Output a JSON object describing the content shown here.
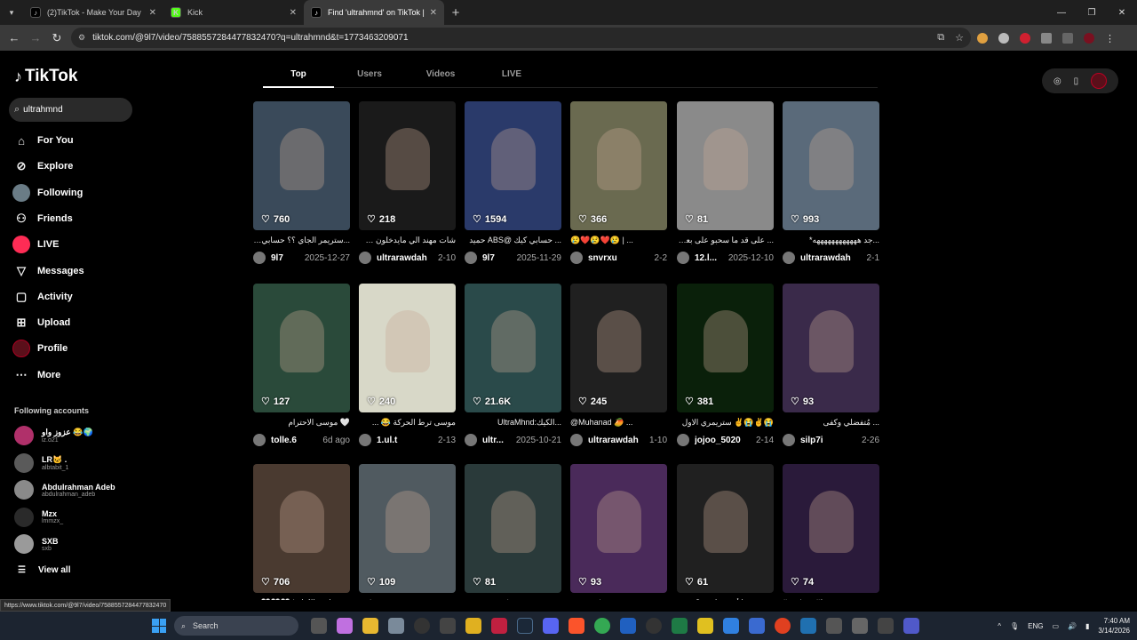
{
  "browser": {
    "tabs": [
      {
        "title": "(2)TikTok - Make Your Day",
        "favicon_color": "#000000",
        "active": false
      },
      {
        "title": "Kick",
        "favicon_color": "#53fc18",
        "active": false
      },
      {
        "title": "Find 'ultrahmnd' on TikTok | Tik",
        "favicon_color": "#000000",
        "active": true
      }
    ],
    "new_tab": "+",
    "url": "tiktok.com/@9l7/video/7588557284477832470?q=ultrahmnd&t=1773463209071"
  },
  "tiktok": {
    "logo": "TikTok",
    "search_value": "ultrahmnd",
    "nav": [
      {
        "label": "For You",
        "icon": "home-icon"
      },
      {
        "label": "Explore",
        "icon": "compass-icon"
      },
      {
        "label": "Following",
        "icon": "following-avatar-icon"
      },
      {
        "label": "Friends",
        "icon": "friends-icon"
      },
      {
        "label": "LIVE",
        "icon": "live-icon"
      },
      {
        "label": "Messages",
        "icon": "messages-icon"
      },
      {
        "label": "Activity",
        "icon": "activity-icon"
      },
      {
        "label": "Upload",
        "icon": "upload-icon"
      },
      {
        "label": "Profile",
        "icon": "profile-icon"
      },
      {
        "label": "More",
        "icon": "more-icon"
      }
    ],
    "following_title": "Following accounts",
    "following_accounts": [
      {
        "name": "عزوز واو 😂🌍",
        "handle": "iz.o21",
        "color": "#b0306a"
      },
      {
        "name": "LR🐱 .",
        "handle": "albtabit_1",
        "color": "#5a5a5a"
      },
      {
        "name": "Abdulrahman Adeb",
        "handle": "abdulrahman_adeb",
        "color": "#8a8a8a"
      },
      {
        "name": "Mzx",
        "handle": "lmmzx_",
        "color": "#2a2a2a"
      },
      {
        "name": "SXB",
        "handle": "sxb",
        "color": "#9a9a9a"
      }
    ],
    "view_all": "View all",
    "search_tabs": [
      "Top",
      "Users",
      "Videos",
      "LIVE"
    ],
    "active_tab": "Top",
    "videos": [
      {
        "views": "760",
        "caption": "...ستريمر الجاي ؟؟ حسابي كيك",
        "user": "9l7",
        "date": "2025-12-27",
        "bg": "#3a4a5a"
      },
      {
        "views": "218",
        "caption": "شات مهند الي مايدخلون 😂 أقسم بالله افضل شات",
        "user": "ultrarawdah",
        "date": "2-10",
        "bg": "#1a1a1a"
      },
      {
        "views": "1594",
        "caption": "... حسابي كيك @ABS حميد",
        "user": "9l7",
        "date": "2025-11-29",
        "bg": "#2a3a6a"
      },
      {
        "views": "366",
        "caption": "😢❤️😢❤️😢 | ...",
        "user": "snvrxu",
        "date": "2-2",
        "bg": "#6a6a50"
      },
      {
        "views": "81",
        "caption": "... على قد ما سحبو على بعض",
        "user": "12.l...",
        "date": "2025-12-10",
        "bg": "#8a8a8a"
      },
      {
        "views": "993",
        "caption": "...جد ههههههههههههه*",
        "user": "ultrarawdah",
        "date": "2-1",
        "bg": "#5a6a7a"
      },
      {
        "views": "127",
        "caption": "🤍 موسى الاحترام",
        "user": "tolle.6",
        "date": "6d ago",
        "bg": "#2a4a3a"
      },
      {
        "views": "240",
        "caption": "موسى ترط الحركة 😂 ...",
        "user": "1.ul.t",
        "date": "2-13",
        "bg": "#d8d8c8"
      },
      {
        "views": "21.6K",
        "caption": "...الكيك:UltraMhnd",
        "user": "ultr...",
        "date": "2025-10-21",
        "bg": "#2a4a4a"
      },
      {
        "views": "245",
        "caption": "@Muhanad 🥭 ...",
        "user": "ultrarawdah",
        "date": "1-10",
        "bg": "#202020"
      },
      {
        "views": "381",
        "caption": "😭✌️😭✌️ ستريمري الاول",
        "user": "jojoo_5020",
        "date": "2-14",
        "bg": "#0a200a"
      },
      {
        "views": "93",
        "caption": "... مُتفضلي وكفى",
        "user": "silp7i",
        "date": "2-26",
        "bg": "#3a2a4a"
      },
      {
        "views": "706",
        "caption": "...حسابي بالكيك | 🤍🤍🤍",
        "user": "",
        "date": "",
        "bg": "#4a3a30"
      },
      {
        "views": "109",
        "caption": "...ي عقده ههههههههههههه*",
        "user": "",
        "date": "",
        "bg": "#505a60"
      },
      {
        "views": "81",
        "caption": "...هههههههههههه*",
        "user": "",
        "date": "",
        "bg": "#2a3a3a"
      },
      {
        "views": "93",
        "caption": "...يوم هههههههههههه*",
        "user": "",
        "date": "",
        "bg": "#4a2a5a"
      },
      {
        "views": "61",
        "caption": "...ترند وما أسويه لمهند؟ عربيه",
        "user": "",
        "date": "",
        "bg": "#202020"
      },
      {
        "views": "74",
        "caption": "#explore #fyp ...",
        "user": "",
        "date": "",
        "bg": "#2a1a3a"
      }
    ],
    "status_url": "https://www.tiktok.com/@9l7/video/7588557284477832470"
  },
  "taskbar": {
    "search_label": "Search",
    "lang": "ENG",
    "time": "7:40 AM",
    "date": "3/14/2026"
  }
}
